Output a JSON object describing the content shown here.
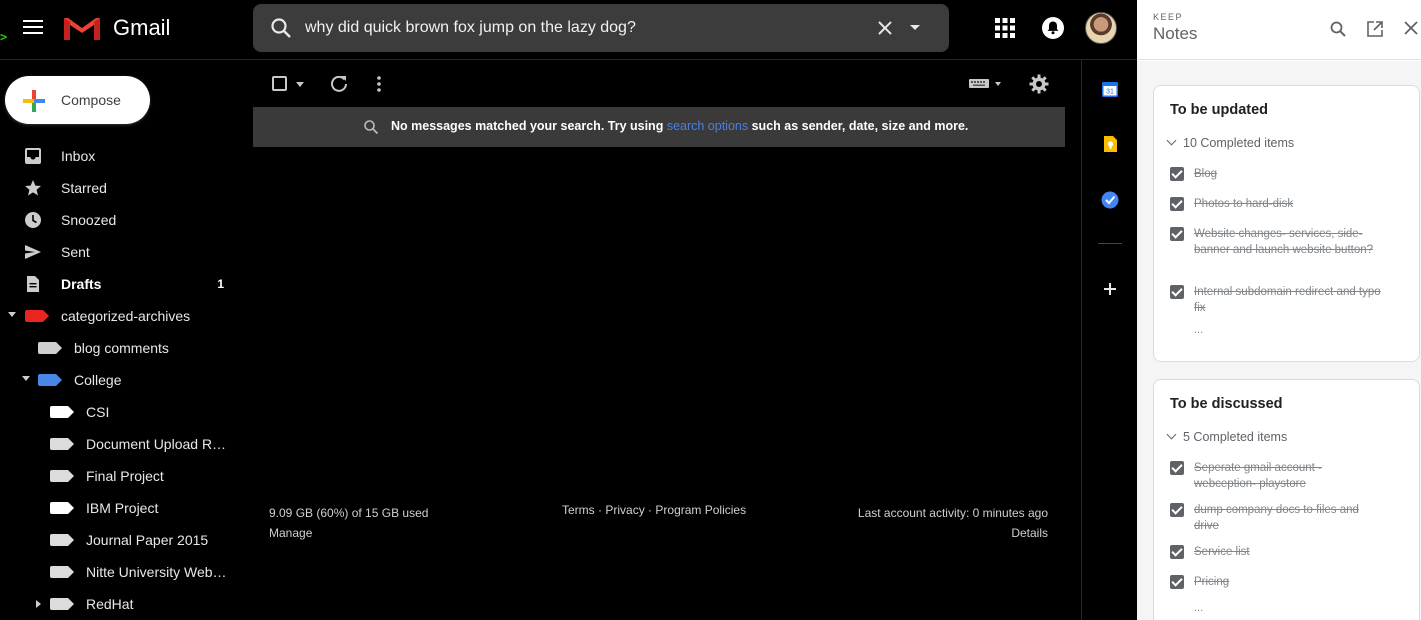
{
  "header": {
    "app_name": "Gmail",
    "terminal_glyph": ">",
    "search_value": "why did quick brown fox jump on the lazy dog?"
  },
  "sidebar": {
    "compose_label": "Compose",
    "items": [
      {
        "label": "Inbox",
        "icon": "inbox-icon"
      },
      {
        "label": "Starred",
        "icon": "star-icon"
      },
      {
        "label": "Snoozed",
        "icon": "clock-icon"
      },
      {
        "label": "Sent",
        "icon": "send-icon"
      },
      {
        "label": "Drafts",
        "icon": "draft-icon",
        "count": "1"
      }
    ],
    "labels": [
      {
        "label": "categorized-archives",
        "color": "#e8261f"
      },
      {
        "label": "blog comments",
        "color": "#cfcfcf"
      },
      {
        "label": "College",
        "color": "#4a86e8"
      },
      {
        "label": "CSI",
        "color": "#ffffff"
      },
      {
        "label": "Document Upload R…",
        "color": "#dcdcdc"
      },
      {
        "label": "Final Project",
        "color": "#dcdcdc"
      },
      {
        "label": "IBM Project",
        "color": "#ffffff"
      },
      {
        "label": "Journal Paper 2015",
        "color": "#dcdcdc"
      },
      {
        "label": "Nitte University Web…",
        "color": "#dcdcdc"
      },
      {
        "label": "RedHat",
        "color": "#dcdcdc"
      }
    ]
  },
  "main": {
    "banner_text": "No messages matched your search. Try using",
    "banner_link": "search options",
    "banner_tail": "such as sender, date, size and more.",
    "storage": "9.09 GB (60%) of 15 GB used",
    "manage": "Manage",
    "terms": "Terms",
    "privacy": "Privacy",
    "policies": "Program Policies",
    "sep": "·",
    "activity": "Last account activity: 0 minutes ago",
    "details": "Details"
  },
  "keep": {
    "brand": "KEEP",
    "title": "Notes",
    "notes": [
      {
        "title": "To be updated",
        "completed": "10 Completed items",
        "items": [
          "Blog",
          "Photos to hard-disk",
          "Website changes- services, side-banner and launch website button?",
          "Internal subdomain redirect and typo fix"
        ],
        "more": "..."
      },
      {
        "title": "To be discussed",
        "completed": "5 Completed items",
        "items": [
          "Seperate gmail account - webception- playstore",
          "dump company docs to files and drive",
          "Service list",
          "Pricing"
        ],
        "more": "..."
      }
    ]
  },
  "strip": {
    "calendar_day": "31"
  },
  "colors": {
    "accent_blue": "#4a86e8",
    "red_label": "#e8261f",
    "keep_yellow": "#fbbc04"
  }
}
